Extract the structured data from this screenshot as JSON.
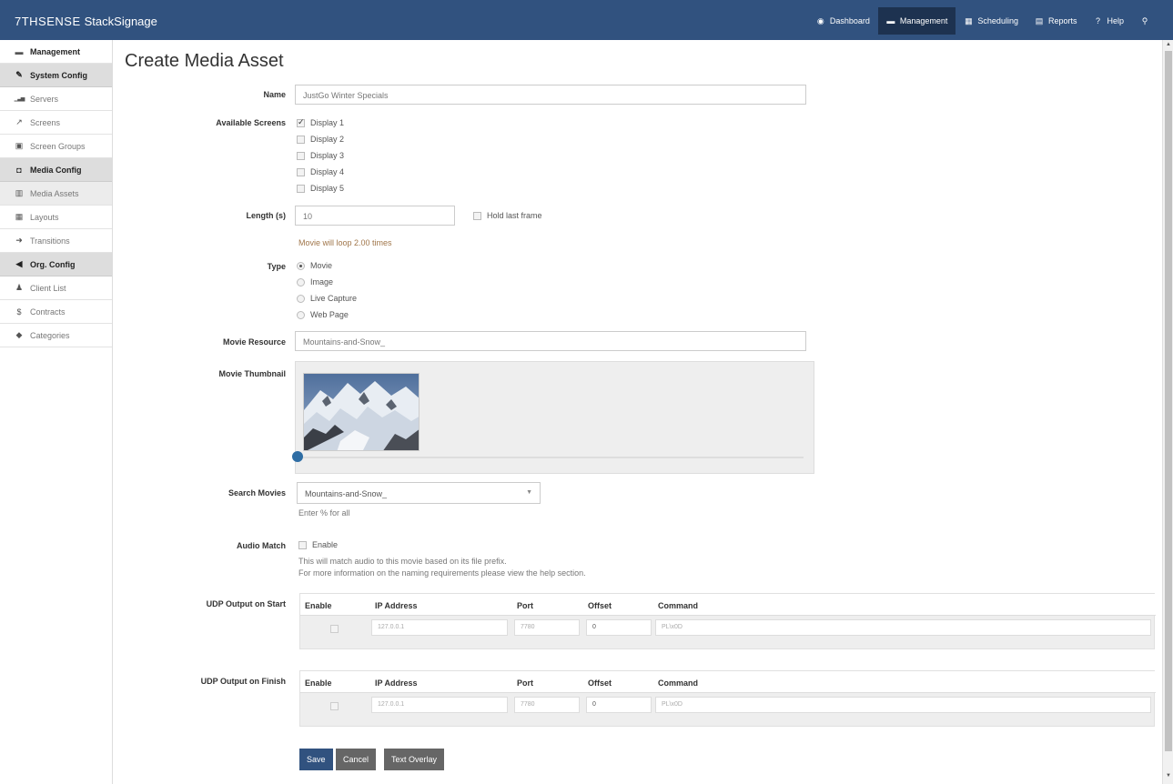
{
  "brand": {
    "prefix": "7THSENSE",
    "app": "StackSignage"
  },
  "nav": [
    {
      "icon": "dashboard-icon",
      "glyph": "◉",
      "label": "Dashboard",
      "active": false
    },
    {
      "icon": "management-icon",
      "glyph": "▬",
      "label": "Management",
      "active": true
    },
    {
      "icon": "calendar-icon",
      "glyph": "▦",
      "label": "Scheduling",
      "active": false
    },
    {
      "icon": "reports-icon",
      "glyph": "▤",
      "label": "Reports",
      "active": false
    },
    {
      "icon": "help-icon",
      "glyph": "?",
      "label": "Help",
      "active": false
    },
    {
      "icon": "user-icon",
      "glyph": "⚲",
      "label": "",
      "active": false
    }
  ],
  "sidebar": {
    "items": [
      {
        "label": "Management",
        "glyph": "▬",
        "icon": "management-icon",
        "kind": "top"
      },
      {
        "label": "System Config",
        "glyph": "✎",
        "icon": "wrench-icon",
        "kind": "group"
      },
      {
        "label": "Servers",
        "glyph": "▁▃▅",
        "icon": "signal-icon",
        "kind": "item"
      },
      {
        "label": "Screens",
        "glyph": "↗",
        "icon": "external-link-icon",
        "kind": "item"
      },
      {
        "label": "Screen Groups",
        "glyph": "▣",
        "icon": "screen-groups-icon",
        "kind": "item"
      },
      {
        "label": "Media Config",
        "glyph": "◘",
        "icon": "media-icon",
        "kind": "group"
      },
      {
        "label": "Media Assets",
        "glyph": "▥",
        "icon": "film-icon",
        "kind": "selected"
      },
      {
        "label": "Layouts",
        "glyph": "▦",
        "icon": "grid-icon",
        "kind": "item"
      },
      {
        "label": "Transitions",
        "glyph": "➜",
        "icon": "arrow-icon",
        "kind": "item"
      },
      {
        "label": "Org. Config",
        "glyph": "◀",
        "icon": "megaphone-icon",
        "kind": "group"
      },
      {
        "label": "Client List",
        "glyph": "♟",
        "icon": "person-icon",
        "kind": "item"
      },
      {
        "label": "Contracts",
        "glyph": "$",
        "icon": "dollar-icon",
        "kind": "item"
      },
      {
        "label": "Categories",
        "glyph": "◆",
        "icon": "tags-icon",
        "kind": "item"
      }
    ]
  },
  "page": {
    "title": "Create Media Asset"
  },
  "form": {
    "name_label": "Name",
    "name_value": "JustGo Winter Specials",
    "screens_label": "Available Screens",
    "screens": [
      {
        "label": "Display 1",
        "checked": true
      },
      {
        "label": "Display 2",
        "checked": false
      },
      {
        "label": "Display 3",
        "checked": false
      },
      {
        "label": "Display 4",
        "checked": false
      },
      {
        "label": "Display 5",
        "checked": false
      }
    ],
    "length_label": "Length (s)",
    "length_value": "10",
    "hold_last_frame_label": "Hold last frame",
    "loop_hint": "Movie will loop 2.00 times",
    "type_label": "Type",
    "types": [
      {
        "label": "Movie",
        "checked": true
      },
      {
        "label": "Image",
        "checked": false
      },
      {
        "label": "Live Capture",
        "checked": false
      },
      {
        "label": "Web Page",
        "checked": false
      }
    ],
    "movie_resource_label": "Movie Resource",
    "movie_resource_value": "Mountains-and-Snow_",
    "movie_thumbnail_label": "Movie Thumbnail",
    "search_movies_label": "Search Movies",
    "search_movies_value": "Mountains-and-Snow_",
    "search_hint": "Enter % for all",
    "audio_match_label": "Audio Match",
    "audio_enable_label": "Enable",
    "audio_hint_1": "This will match audio to this movie based on its file prefix.",
    "audio_hint_2": "For more information on the naming requirements please view the help section."
  },
  "udp": {
    "headers": [
      "Enable",
      "IP Address",
      "Port",
      "Offset",
      "Command"
    ],
    "start": {
      "label": "UDP Output on Start",
      "ip": "127.0.0.1",
      "port": "7780",
      "offset": "0",
      "command": "PL\\x0D"
    },
    "finish": {
      "label": "UDP Output on Finish",
      "ip": "127.0.0.1",
      "port": "7780",
      "offset": "0",
      "command": "PL\\x0D"
    }
  },
  "buttons": {
    "save": "Save",
    "cancel": "Cancel",
    "text_overlay": "Text Overlay"
  },
  "colors": {
    "navbar": "#31527f",
    "active_nav": "#1d3250",
    "primary_button": "#31527f"
  }
}
